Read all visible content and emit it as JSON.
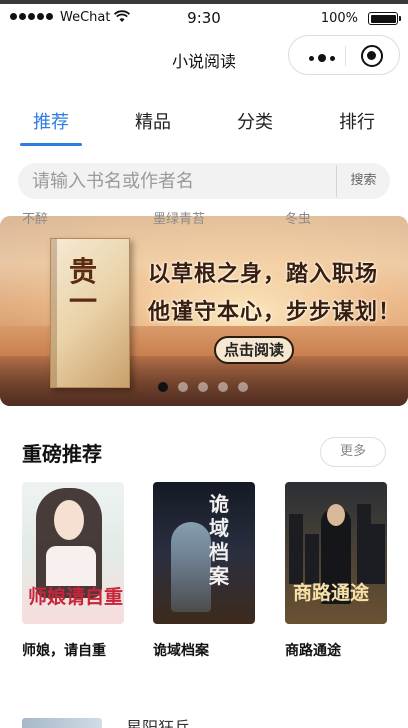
{
  "status_bar": {
    "carrier": "WeChat",
    "time": "9:30",
    "battery": "100%",
    "battery_level": 1.0
  },
  "nav": {
    "title": "小说阅读"
  },
  "tabs": [
    {
      "label": "推荐",
      "active": true
    },
    {
      "label": "精品",
      "active": false
    },
    {
      "label": "分类",
      "active": false
    },
    {
      "label": "排行",
      "active": false
    }
  ],
  "search": {
    "placeholder": "请输入书名或作者名",
    "button": "搜索"
  },
  "banner": {
    "book_title": "贵一",
    "line1": "以草根之身，踏入职场",
    "line2": "他谨守本心，步步谋划！",
    "cta": "点击阅读",
    "slide_count": 5,
    "active_slide": 0
  },
  "section": {
    "title": "重磅推荐",
    "more": "更多"
  },
  "books": [
    {
      "title": "师娘，请自重",
      "author": "不醉",
      "cover_text": "师娘请自重"
    },
    {
      "title": "诡域档案",
      "author": "墨绿青苔",
      "cover_text": "诡域档案"
    },
    {
      "title": "商路通途",
      "author": "冬虫",
      "cover_text": "商路通途"
    }
  ],
  "next_item": {
    "title": "星阳狂兵"
  },
  "colors": {
    "accent": "#2f7de1",
    "text": "#111111",
    "muted": "#8a8a8a"
  }
}
